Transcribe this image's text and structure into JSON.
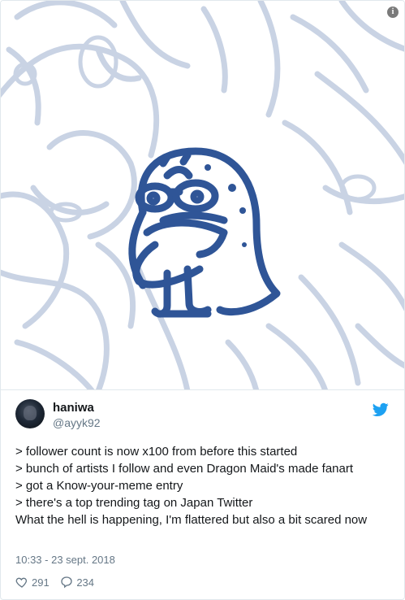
{
  "tweet": {
    "author": {
      "name": "haniwa",
      "handle": "@ayyk92"
    },
    "lines": [
      "> follower count is now x100 from before this started",
      "> bunch of artists I follow and even Dragon Maid's made fanart",
      "> got a Know-your-meme entry",
      "> there's a top trending tag on Japan Twitter",
      "What the hell is happening, I'm flattered but also a bit scared now"
    ],
    "timestamp": "10:33 - 23 sept. 2018",
    "likes": "291",
    "replies": "234"
  },
  "icons": {
    "info": "info-icon",
    "twitter": "twitter-bird-icon",
    "like": "heart-icon",
    "reply": "reply-icon"
  },
  "colors": {
    "sketch": "#2f5597",
    "sketch_light": "#c9d3e4",
    "twitter_blue": "#1da1f2",
    "secondary_text": "#657786"
  },
  "media": {
    "info_glyph": "i"
  }
}
